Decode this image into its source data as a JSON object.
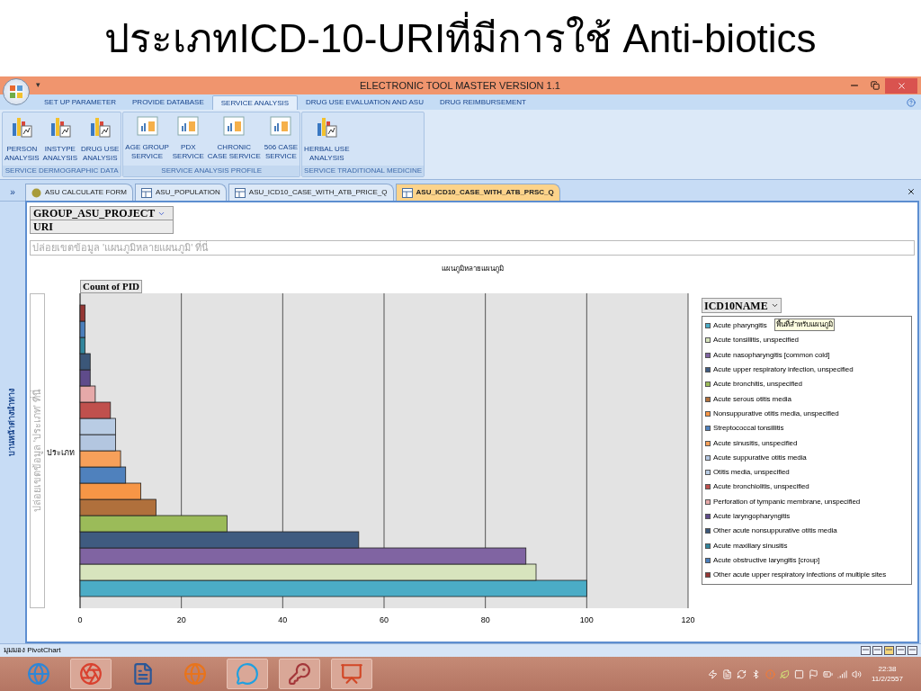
{
  "slide_title": "ประเภทICD-10-URIที่มีการใช้ Anti-biotics",
  "window": {
    "title": "ELECTRONIC TOOL MASTER VERSION 1.1",
    "quick_access": "▾"
  },
  "ribbon_tabs": [
    {
      "label": "SET UP PARAMETER",
      "selected": false
    },
    {
      "label": "PROVIDE DATABASE",
      "selected": false
    },
    {
      "label": "SERVICE ANALYSIS",
      "selected": true
    },
    {
      "label": "DRUG USE EVALUATION AND ASU",
      "selected": false
    },
    {
      "label": "DRUG REIMBURSEMENT",
      "selected": false
    }
  ],
  "ribbon_groups": [
    {
      "label": "SERVICE DERMOGRAPHIC DATA",
      "buttons": [
        {
          "lines": [
            "PERSON",
            "ANALYSIS"
          ],
          "kind": "pivot"
        },
        {
          "lines": [
            "INSTYPE",
            "ANALYSIS"
          ],
          "kind": "pivot"
        },
        {
          "lines": [
            "DRUG USE",
            "ANALYSIS"
          ],
          "kind": "pivot"
        }
      ]
    },
    {
      "label": "SERVICE ANALYSIS PROFILE",
      "buttons": [
        {
          "lines": [
            "AGE GROUP",
            "SERVICE"
          ],
          "kind": "report"
        },
        {
          "lines": [
            "PDX",
            "SERVICE"
          ],
          "kind": "report"
        },
        {
          "lines": [
            "CHRONIC",
            "CASE SERVICE"
          ],
          "kind": "report"
        },
        {
          "lines": [
            "506 CASE",
            "SERVICE"
          ],
          "kind": "report"
        }
      ]
    },
    {
      "label": "SERVICE TRADITIONAL MEDICINE",
      "buttons": [
        {
          "lines": [
            "HERBAL USE",
            "ANALYSIS"
          ],
          "kind": "pivot"
        }
      ]
    }
  ],
  "nav_pane": {
    "toggle": "»",
    "label": "บานหน้าต่างนำทาง"
  },
  "doc_tabs": [
    {
      "label": "ASU CALCULATE FORM",
      "kind": "form",
      "selected": false
    },
    {
      "label": "ASU_POPULATION",
      "kind": "query",
      "selected": false
    },
    {
      "label": "ASU_ICD10_CASE_WITH_ATB_PRICE_Q",
      "kind": "query",
      "selected": false
    },
    {
      "label": "ASU_ICD10_CASE_WITH_ATB_PRSC_Q",
      "kind": "query",
      "selected": true
    }
  ],
  "pivot": {
    "filter_field": "GROUP_ASU_PROJECT",
    "filter_value": "URI",
    "drop_zone": "ปล่อยเขตข้อมูล 'แผนภูมิหลายแผนภูมิ' ที่นี่",
    "data_field": "Count of PID",
    "row_drop_zone": "ปล่อยเขตข้อมูล 'ประเภท' ที่นี่",
    "legend_field": "ICD10NAME",
    "tooltip": "พื้นที่สำหรับแผนภูมิ",
    "chart_data": {
      "type": "bar",
      "orientation": "horizontal",
      "title": "แผนภูมิหลายแผนภูมิ",
      "categories": [
        "ประเภท"
      ],
      "xlim": [
        0,
        120
      ],
      "grid": true,
      "xticks": [
        0,
        20,
        40,
        60,
        80,
        100,
        120
      ],
      "series": [
        {
          "name": "Acute pharyngitis",
          "color": "#4bacc6",
          "values": [
            100
          ]
        },
        {
          "name": "Acute tonsillitis, unspecified",
          "color": "#d7e4bd",
          "values": [
            90
          ]
        },
        {
          "name": "Acute nasopharyngitis [common cold]",
          "color": "#8064a2",
          "values": [
            88
          ]
        },
        {
          "name": "Acute upper respiratory infection, unspecified",
          "color": "#3f5b80",
          "values": [
            55
          ]
        },
        {
          "name": "Acute bronchitis, unspecified",
          "color": "#9bbb59",
          "values": [
            29
          ]
        },
        {
          "name": "Acute serous otitis media",
          "color": "#b0703c",
          "values": [
            15
          ]
        },
        {
          "name": "Nonsuppurative otitis media, unspecified",
          "color": "#f79646",
          "values": [
            12
          ]
        },
        {
          "name": "Streptococcal tonsillitis",
          "color": "#4f81bd",
          "values": [
            9
          ]
        },
        {
          "name": "Acute sinusitis, unspecified",
          "color": "#f7a05a",
          "values": [
            8
          ]
        },
        {
          "name": "Acute suppurative otitis media",
          "color": "#b3c6e0",
          "values": [
            7
          ]
        },
        {
          "name": "Otitis media, unspecified",
          "color": "#b9cce4",
          "values": [
            7
          ]
        },
        {
          "name": "Acute bronchiolitis, unspecified",
          "color": "#c0504d",
          "values": [
            6
          ]
        },
        {
          "name": "Perforation of tympanic membrane, unspecified",
          "color": "#e6a9a9",
          "values": [
            3
          ]
        },
        {
          "name": "Acute laryngopharyngitis",
          "color": "#5f4b8b",
          "values": [
            2
          ]
        },
        {
          "name": "Other acute nonsuppurative otitis media",
          "color": "#3b5779",
          "values": [
            2
          ]
        },
        {
          "name": "Acute maxillary sinusitis",
          "color": "#31859c",
          "values": [
            1
          ]
        },
        {
          "name": "Acute obstructive laryngitis [croup]",
          "color": "#4a7ebb",
          "values": [
            1
          ]
        },
        {
          "name": "Other acute upper respiratory infections of multiple sites",
          "color": "#953735",
          "values": [
            1
          ]
        }
      ]
    }
  },
  "status_bar": {
    "text": "มุมมอง PivotChart"
  },
  "taskbar": {
    "apps": [
      {
        "kind": "browser",
        "running": false
      },
      {
        "kind": "wheel",
        "running": true
      },
      {
        "kind": "document",
        "running": false
      },
      {
        "kind": "globe",
        "running": false
      },
      {
        "kind": "chat",
        "running": true
      },
      {
        "kind": "key",
        "running": true
      },
      {
        "kind": "slides",
        "running": true
      }
    ],
    "clock": {
      "time": "22:38",
      "date": "11/2/2557"
    }
  }
}
